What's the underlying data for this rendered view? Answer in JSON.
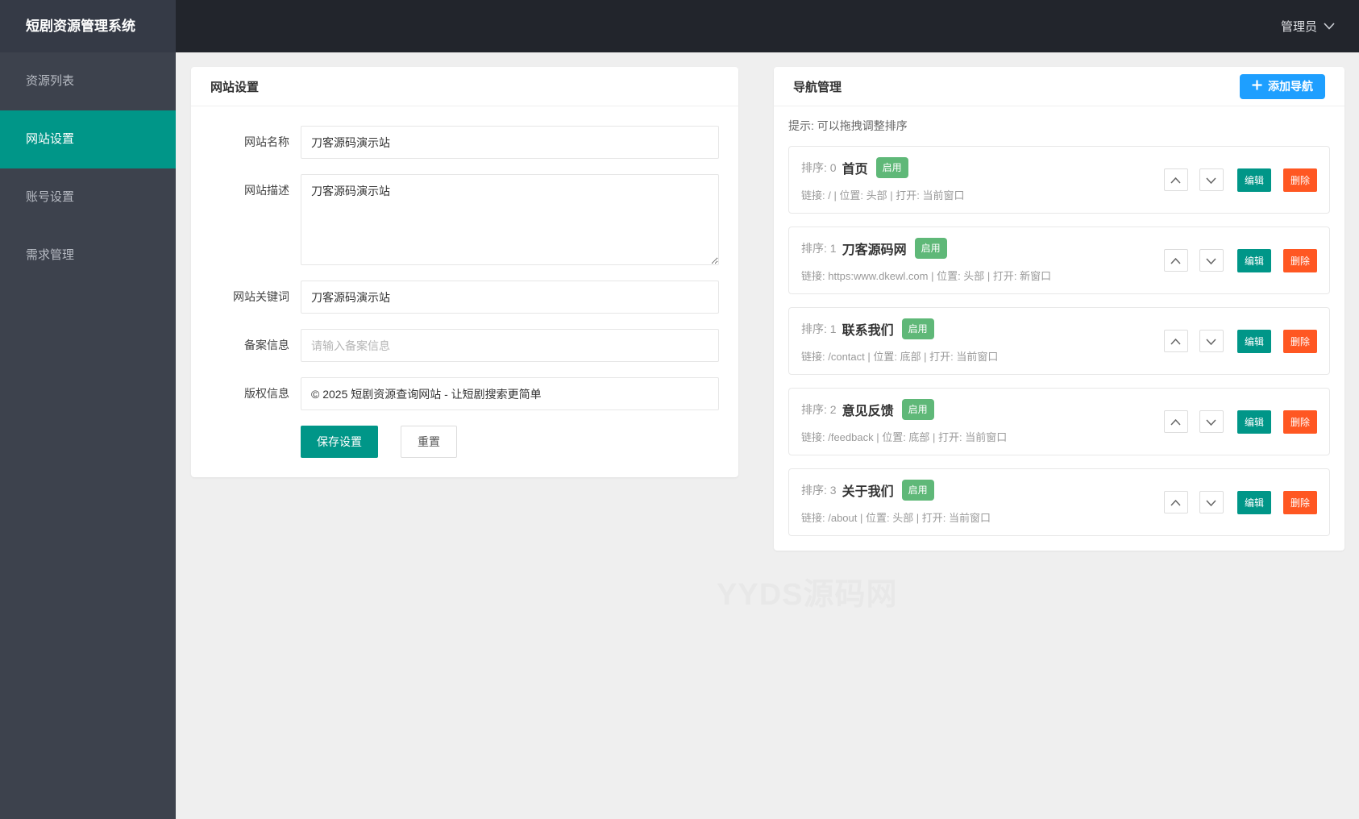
{
  "app": {
    "title": "短剧资源管理系统",
    "user_menu": {
      "label": "管理员"
    }
  },
  "sidebar": {
    "items": [
      {
        "label": "资源列表",
        "active": false
      },
      {
        "label": "网站设置",
        "active": true
      },
      {
        "label": "账号设置",
        "active": false
      },
      {
        "label": "需求管理",
        "active": false
      }
    ]
  },
  "site_settings": {
    "title": "网站设置",
    "fields": {
      "name": {
        "label": "网站名称",
        "value": "刀客源码演示站"
      },
      "description": {
        "label": "网站描述",
        "value": "刀客源码演示站"
      },
      "keywords": {
        "label": "网站关键词",
        "value": "刀客源码演示站"
      },
      "icp": {
        "label": "备案信息",
        "value": "",
        "placeholder": "请输入备案信息"
      },
      "copyright": {
        "label": "版权信息",
        "value": "© 2025 短剧资源查询网站 - 让短剧搜索更简单"
      }
    },
    "buttons": {
      "save": "保存设置",
      "reset": "重置"
    }
  },
  "nav_management": {
    "title": "导航管理",
    "add_button": "添加导航",
    "hint": "提示: 可以拖拽调整排序",
    "row_buttons": {
      "edit": "编辑",
      "delete": "删除"
    },
    "items": [
      {
        "sort": "排序: 0",
        "name": "首页",
        "status": "启用",
        "meta": "链接: / | 位置: 头部 | 打开: 当前窗口"
      },
      {
        "sort": "排序: 1",
        "name": "刀客源码网",
        "status": "启用",
        "meta": "链接: https:www.dkewl.com | 位置: 头部 | 打开: 新窗口"
      },
      {
        "sort": "排序: 1",
        "name": "联系我们",
        "status": "启用",
        "meta": "链接: /contact | 位置: 底部 | 打开: 当前窗口"
      },
      {
        "sort": "排序: 2",
        "name": "意见反馈",
        "status": "启用",
        "meta": "链接: /feedback | 位置: 底部 | 打开: 当前窗口"
      },
      {
        "sort": "排序: 3",
        "name": "关于我们",
        "status": "启用",
        "meta": "链接: /about | 位置: 头部 | 打开: 当前窗口"
      }
    ]
  },
  "watermark": "YYDS源码网",
  "colors": {
    "accent_teal": "#009688",
    "accent_blue": "#1e9fff",
    "success_green": "#5fb878",
    "danger_orange": "#ff5722",
    "sidebar_dark": "#3d424d",
    "topbar_dark": "#22252c"
  }
}
